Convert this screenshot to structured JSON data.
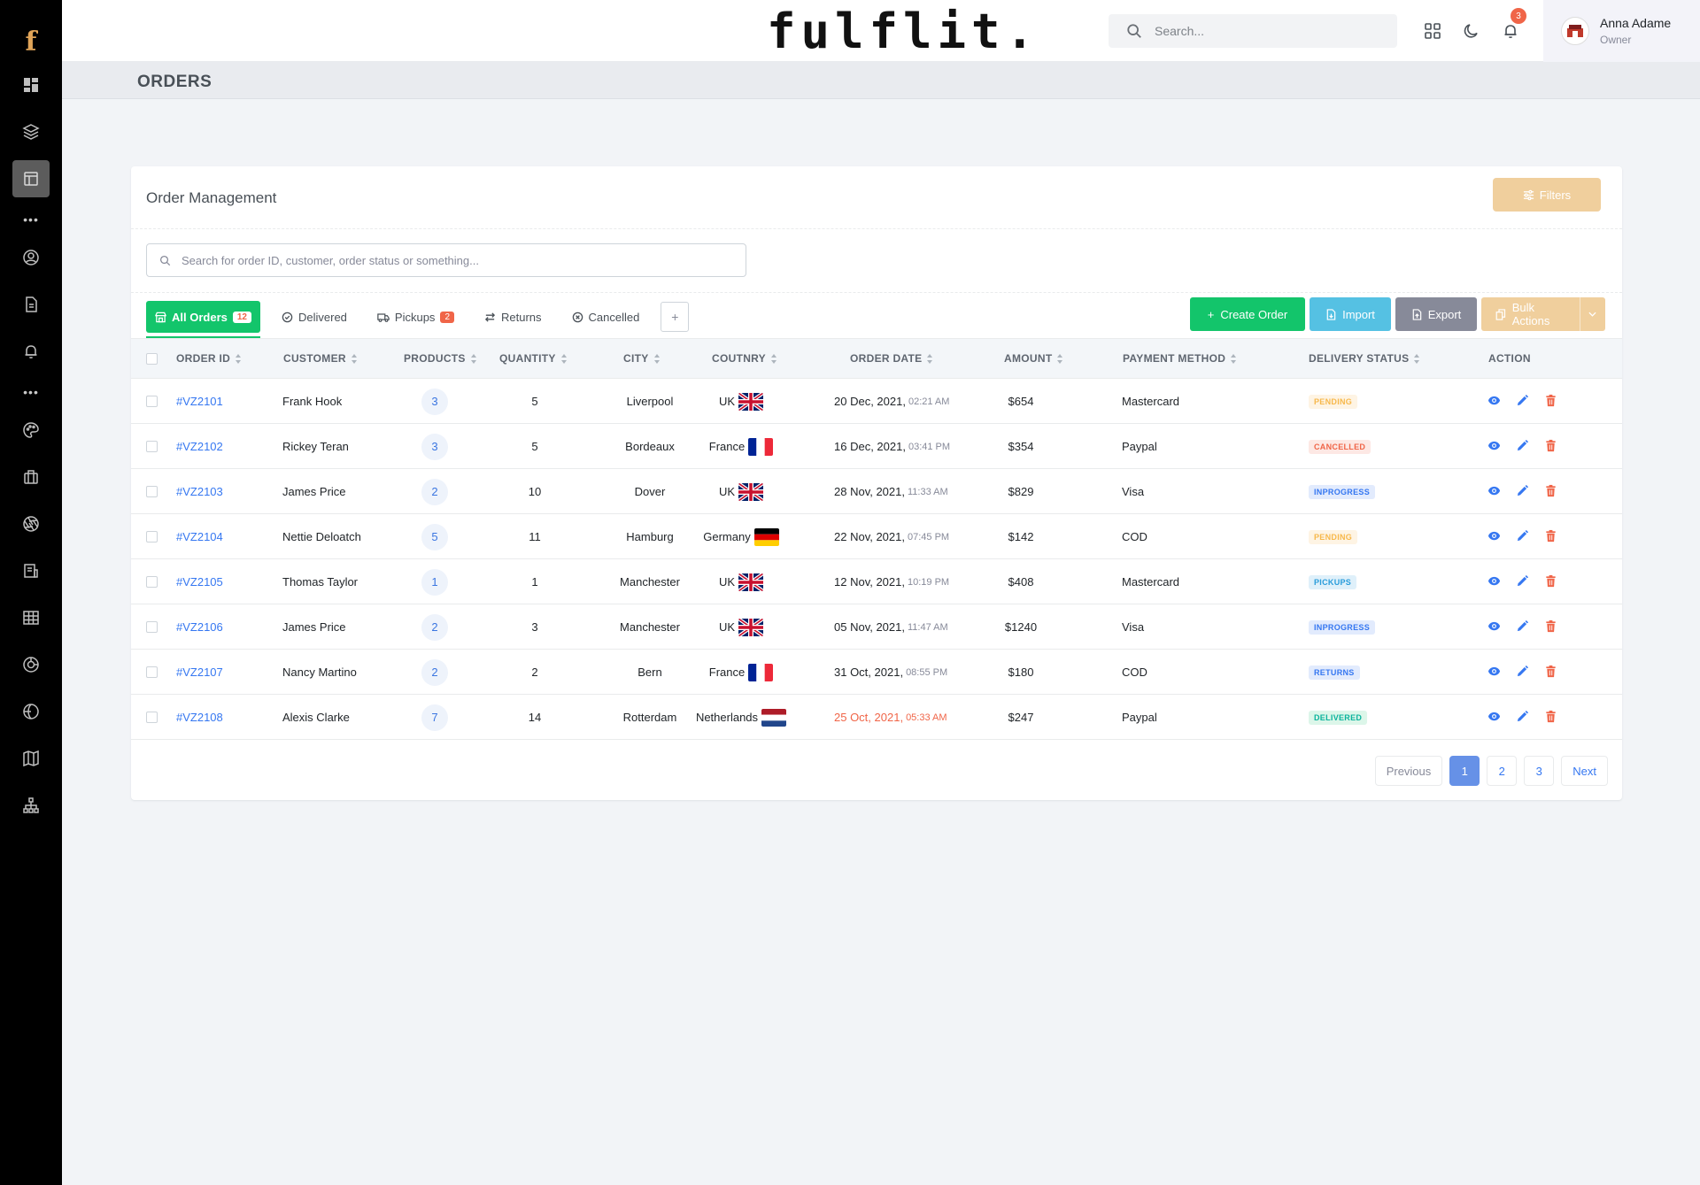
{
  "app": {
    "brand": "fulflit.",
    "logo_letter": "f"
  },
  "header": {
    "search_placeholder": "Search...",
    "notification_count": "3",
    "user_name": "Anna Adame",
    "user_role": "Owner"
  },
  "page": {
    "title": "ORDERS"
  },
  "card": {
    "title": "Order Management",
    "filters_label": "Filters",
    "search_placeholder": "Search for order ID, customer, order status or something..."
  },
  "tabs": [
    {
      "label": "All Orders",
      "badge": "12"
    },
    {
      "label": "Delivered"
    },
    {
      "label": "Pickups",
      "badge": "2"
    },
    {
      "label": "Returns"
    },
    {
      "label": "Cancelled"
    }
  ],
  "tab_add_label": "+",
  "actions": {
    "create": "Create Order",
    "import": "Import",
    "export": "Export",
    "bulk": "Bulk Actions"
  },
  "columns": [
    "ORDER ID",
    "CUSTOMER",
    "PRODUCTS",
    "QUANTITY",
    "CITY",
    "COUTNRY",
    "ORDER DATE",
    "AMOUNT",
    "PAYMENT METHOD",
    "DELIVERY STATUS",
    "ACTION"
  ],
  "orders": [
    {
      "id": "#VZ2101",
      "customer": "Frank Hook",
      "products": "3",
      "quantity": "5",
      "city": "Liverpool",
      "country": "UK",
      "flag": "uk",
      "date": "20 Dec, 2021,",
      "time": "02:21 AM",
      "amount": "$654",
      "payment": "Mastercard",
      "status": "PENDING",
      "status_class": "st-pending"
    },
    {
      "id": "#VZ2102",
      "customer": "Rickey Teran",
      "products": "3",
      "quantity": "5",
      "city": "Bordeaux",
      "country": "France",
      "flag": "fr",
      "date": "16 Dec, 2021,",
      "time": "03:41 PM",
      "amount": "$354",
      "payment": "Paypal",
      "status": "CANCELLED",
      "status_class": "st-cancelled"
    },
    {
      "id": "#VZ2103",
      "customer": "James Price",
      "products": "2",
      "quantity": "10",
      "city": "Dover",
      "country": "UK",
      "flag": "uk",
      "date": "28 Nov, 2021,",
      "time": "11:33 AM",
      "amount": "$829",
      "payment": "Visa",
      "status": "INPROGRESS",
      "status_class": "st-inprogress"
    },
    {
      "id": "#VZ2104",
      "customer": "Nettie Deloatch",
      "products": "5",
      "quantity": "11",
      "city": "Hamburg",
      "country": "Germany",
      "flag": "de",
      "date": "22 Nov, 2021,",
      "time": "07:45 PM",
      "amount": "$142",
      "payment": "COD",
      "status": "PENDING",
      "status_class": "st-pending"
    },
    {
      "id": "#VZ2105",
      "customer": "Thomas Taylor",
      "products": "1",
      "quantity": "1",
      "city": "Manchester",
      "country": "UK",
      "flag": "uk",
      "date": "12 Nov, 2021,",
      "time": "10:19 PM",
      "amount": "$408",
      "payment": "Mastercard",
      "status": "PICKUPS",
      "status_class": "st-pickups"
    },
    {
      "id": "#VZ2106",
      "customer": "James Price",
      "products": "2",
      "quantity": "3",
      "city": "Manchester",
      "country": "UK",
      "flag": "uk",
      "date": "05 Nov, 2021,",
      "time": "11:47 AM",
      "amount": "$1240",
      "payment": "Visa",
      "status": "INPROGRESS",
      "status_class": "st-inprogress"
    },
    {
      "id": "#VZ2107",
      "customer": "Nancy Martino",
      "products": "2",
      "quantity": "2",
      "city": "Bern",
      "country": "France",
      "flag": "fr",
      "date": "31 Oct, 2021,",
      "time": "08:55 PM",
      "amount": "$180",
      "payment": "COD",
      "status": "RETURNS",
      "status_class": "st-returns"
    },
    {
      "id": "#VZ2108",
      "customer": "Alexis Clarke",
      "products": "7",
      "quantity": "14",
      "city": "Rotterdam",
      "country": "Netherlands",
      "flag": "nl",
      "date": "25 Oct, 2021,",
      "time": "05:33 AM",
      "amount": "$247",
      "payment": "Paypal",
      "status": "DELIVERED",
      "status_class": "st-delivered",
      "date_highlight": true
    }
  ],
  "pagination": {
    "previous": "Previous",
    "pages": [
      "1",
      "2",
      "3"
    ],
    "active": "1",
    "next": "Next"
  },
  "sidebar_icons": [
    "dashboard-icon",
    "layers-icon",
    "layout-icon",
    "user-circle-icon",
    "file-icon",
    "bell-icon",
    "palette-icon",
    "briefcase-icon",
    "aperture-icon",
    "form-icon",
    "table-icon",
    "pie-chart-icon",
    "globe-icon",
    "map-icon",
    "sitemap-icon"
  ],
  "colors": {
    "success": "#13c56b",
    "info": "#55c1e3",
    "secondary": "#878a99",
    "warning": "#f0cf9d",
    "primary": "#3577f1",
    "danger": "#f06548"
  }
}
